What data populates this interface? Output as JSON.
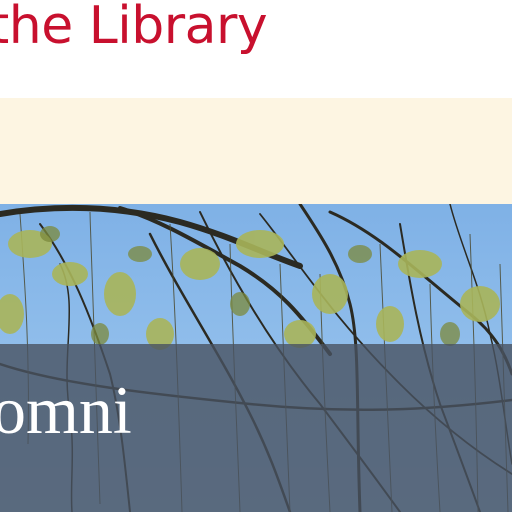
{
  "header": {
    "title": "me to the Library"
  },
  "notice": {
    "text": ""
  },
  "hero": {
    "search_brand": "omni",
    "image": "willow-branches-sky"
  },
  "colors": {
    "title": "#c8102e",
    "notice_background": "#fdf5e2",
    "sky": "#8fbdeb",
    "overlay": "#485262"
  }
}
